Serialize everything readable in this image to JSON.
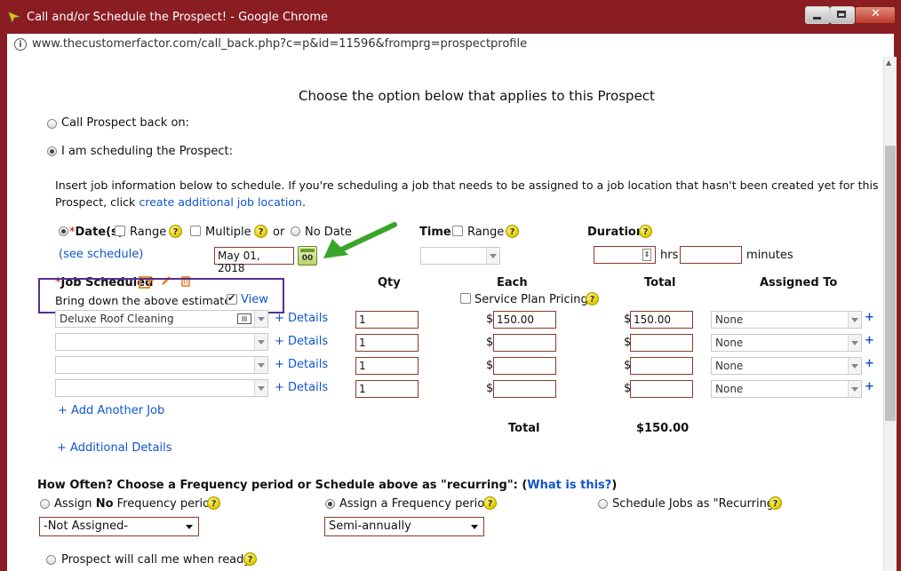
{
  "window": {
    "title": "Call and/or Schedule the Prospect! - Google Chrome",
    "url": "www.thecustomerfactor.com/call_back.php?c=p&id=11596&fromprg=prospectprofile"
  },
  "heading": "Choose the option below that applies to this Prospect",
  "options": {
    "call_back": "Call Prospect back on:",
    "scheduling": "I am scheduling the Prospect:"
  },
  "intro": {
    "text": "Insert job information below to schedule. If you're scheduling a job that needs to be assigned to a job location that hasn't been created yet for this",
    "text2": "Prospect, click",
    "link": "create additional job location",
    "period": "."
  },
  "dates": {
    "label": "Date(s)",
    "required_mark": "*",
    "range": "Range",
    "multiple": "Multiple",
    "or": "or",
    "no_date": "No Date",
    "see_schedule": "(see schedule)",
    "date_value": "May 01, 2018",
    "calendar_label": "00"
  },
  "time": {
    "label": "Time",
    "range": "Range"
  },
  "duration": {
    "label": "Duration",
    "hrs": "hrs",
    "minutes": "minutes"
  },
  "jobs": {
    "header_job": "Job Scheduled",
    "header_required": "*",
    "header_qty": "Qty",
    "header_each": "Each",
    "header_total": "Total",
    "header_assigned": "Assigned To",
    "estimate_label": "Bring down the above estimate:",
    "view": "View",
    "service_plan": "Service Plan Pricing",
    "details": "+ Details",
    "currency": "$",
    "rows": [
      {
        "job": "Deluxe Roof Cleaning",
        "qty": "1",
        "each": "150.00",
        "total": "150.00",
        "assigned": "None"
      },
      {
        "job": "",
        "qty": "1",
        "each": "",
        "total": "",
        "assigned": "None"
      },
      {
        "job": "",
        "qty": "1",
        "each": "",
        "total": "",
        "assigned": "None"
      },
      {
        "job": "",
        "qty": "1",
        "each": "",
        "total": "",
        "assigned": "None"
      }
    ],
    "add_job": "+ Add Another Job",
    "total_label": "Total",
    "total_value": "$150.00",
    "additional_details": "+ Additional Details"
  },
  "frequency": {
    "question": "How Often? Choose a Frequency period or Schedule above as \"recurring\": (",
    "what_link": "What is this?",
    "close_paren": ")",
    "opt_no_pre": "Assign",
    "opt_no_bold": "No",
    "opt_no_post": "Frequency period",
    "opt_assign": "Assign a Frequency period",
    "opt_recurring": "Schedule Jobs as \"Recurring\"",
    "select_no": "-Not Assigned-",
    "select_assign": "Semi-annually"
  },
  "prospect_call": "Prospect will call me when ready.",
  "colors": {
    "frame": "#8a1d22",
    "link": "#1155cc",
    "highlight": "#5b2d91",
    "arrow": "#3aa52a"
  }
}
